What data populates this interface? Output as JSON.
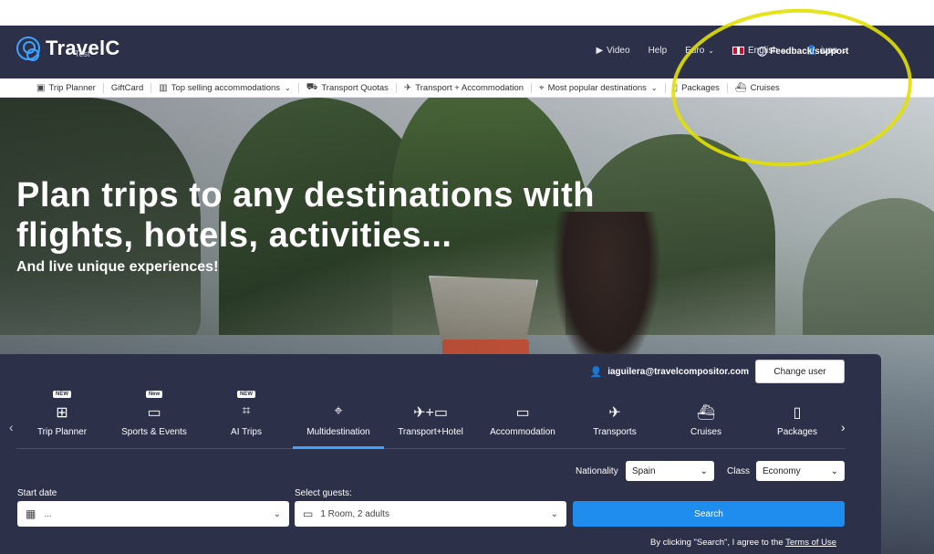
{
  "header": {
    "logo_text": "TravelC",
    "logo_sub": "Test",
    "nav": [
      {
        "icon": "video-icon",
        "label": "Video"
      },
      {
        "label": "Help"
      },
      {
        "label": "Euro"
      },
      {
        "icon": "uk-flag-icon",
        "label": "English"
      },
      {
        "icon": "user-icon",
        "label": "ivan"
      }
    ],
    "feedback_label": "Feedback/support"
  },
  "subnav": [
    {
      "icon": "suitcase-icon",
      "label": "Trip Planner"
    },
    {
      "label": "GiftCard"
    },
    {
      "icon": "building-icon",
      "label": "Top selling accommodations",
      "dropdown": true
    },
    {
      "icon": "bus-icon",
      "label": "Transport Quotas"
    },
    {
      "icon": "plane-bed-icon",
      "label": "Transport + Accommodation"
    },
    {
      "icon": "pin-icon",
      "label": "Most popular destinations",
      "dropdown": true
    },
    {
      "icon": "package-icon",
      "label": "Packages"
    },
    {
      "icon": "ship-icon",
      "label": "Cruises"
    }
  ],
  "hero": {
    "title": "Plan trips to any destinations with flights, hotels, activities...",
    "subtitle": "And live unique experiences!"
  },
  "search_panel": {
    "account_email": "iaguilera@travelcompositor.com",
    "change_user_label": "Change user",
    "tabs": [
      {
        "label": "Trip Planner",
        "badge": "NEW",
        "icon": "map-icon"
      },
      {
        "label": "Sports & Events",
        "badge": "New",
        "icon": "ticket-icon"
      },
      {
        "label": "AI Trips",
        "badge": "NEW",
        "icon": "ai-chip-icon"
      },
      {
        "label": "Multidestination",
        "icon": "location-pin-icon",
        "active": true
      },
      {
        "label": "Transport+Hotel",
        "icon": "plane-plus-bed-icon"
      },
      {
        "label": "Accommodation",
        "icon": "bed-icon"
      },
      {
        "label": "Transports",
        "icon": "plane-icon"
      },
      {
        "label": "Cruises",
        "icon": "ship-icon"
      },
      {
        "label": "Packages",
        "icon": "luggage-icon"
      }
    ],
    "nationality_label": "Nationality",
    "nationality_value": "Spain",
    "class_label": "Class",
    "class_value": "Economy",
    "start_date_label": "Start date",
    "start_date_value": "...",
    "guests_label": "Select guests:",
    "guests_value": "1 Room, 2 adults",
    "search_label": "Search",
    "terms_text": "By clicking \"Search\", I agree to the",
    "terms_link": "Terms of Use"
  },
  "colors": {
    "header_bg": "#2c3048",
    "accent": "#1f8ded",
    "annotation": "#e2e000"
  }
}
